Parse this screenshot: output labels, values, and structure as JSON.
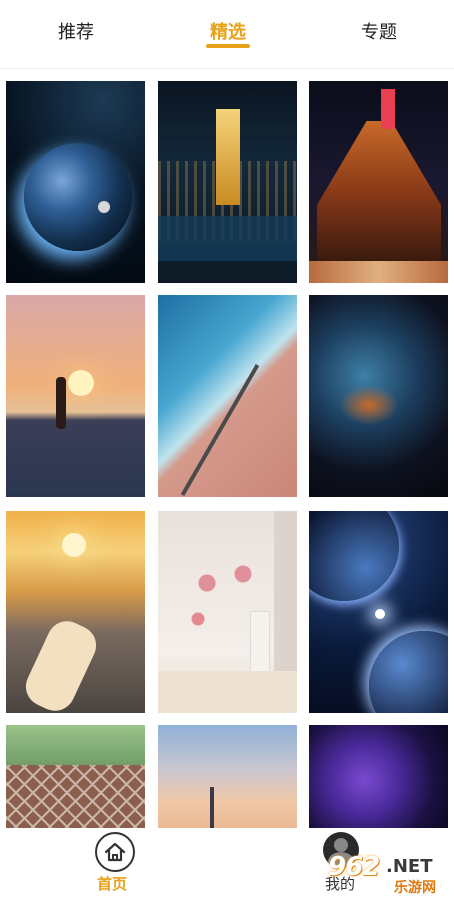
{
  "tabs": [
    {
      "label": "推荐",
      "active": false
    },
    {
      "label": "精选",
      "active": true
    },
    {
      "label": "专题",
      "active": false
    }
  ],
  "accent_color": "#E8A21A",
  "wallpapers": [
    {
      "subject": "earth-in-space"
    },
    {
      "subject": "city-night-tower"
    },
    {
      "subject": "lit-palace-night"
    },
    {
      "subject": "beach-sunset"
    },
    {
      "subject": "aerial-ice-coast"
    },
    {
      "subject": "nebula"
    },
    {
      "subject": "sunrise-valley"
    },
    {
      "subject": "still-life-flowers"
    },
    {
      "subject": "planets-space"
    },
    {
      "subject": "green-lattice"
    },
    {
      "subject": "dusk-sky-tower"
    },
    {
      "subject": "purple-galaxy"
    }
  ],
  "bottom_nav": {
    "home_label": "首页",
    "me_label": "我的"
  },
  "watermark": {
    "number": "962",
    "net": ".NET",
    "sub": "乐游网"
  }
}
